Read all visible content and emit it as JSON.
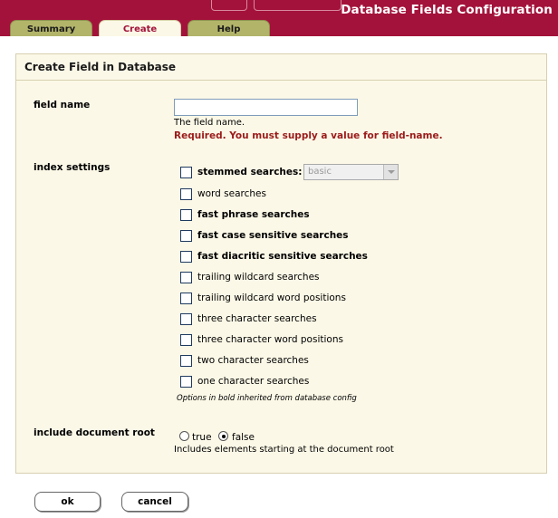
{
  "header": {
    "title": "Database Fields Configuration",
    "tabs": [
      {
        "label": "Summary",
        "active": false
      },
      {
        "label": "Create",
        "active": true
      },
      {
        "label": "Help",
        "active": false
      }
    ]
  },
  "panel": {
    "title": "Create Field in Database"
  },
  "field_name": {
    "label": "field name",
    "value": "",
    "help": "The field name.",
    "error": "Required. You must supply a value for field-name."
  },
  "index_settings": {
    "label": "index settings",
    "stemmed_select_value": "basic",
    "options": [
      {
        "label": "stemmed searches:",
        "bold": true,
        "checked": false
      },
      {
        "label": "word searches",
        "bold": false,
        "checked": false
      },
      {
        "label": "fast phrase searches",
        "bold": true,
        "checked": false
      },
      {
        "label": "fast case sensitive searches",
        "bold": true,
        "checked": false
      },
      {
        "label": "fast diacritic sensitive searches",
        "bold": true,
        "checked": false
      },
      {
        "label": "trailing wildcard searches",
        "bold": false,
        "checked": false
      },
      {
        "label": "trailing wildcard word positions",
        "bold": false,
        "checked": false
      },
      {
        "label": "three character searches",
        "bold": false,
        "checked": false
      },
      {
        "label": "three character word positions",
        "bold": false,
        "checked": false
      },
      {
        "label": "two character searches",
        "bold": false,
        "checked": false
      },
      {
        "label": "one character searches",
        "bold": false,
        "checked": false
      }
    ],
    "note": "Options in bold inherited from database config"
  },
  "include_document_root": {
    "label": "include document root",
    "options": [
      {
        "label": "true",
        "checked": false
      },
      {
        "label": "false",
        "checked": true
      }
    ],
    "help": "Includes elements starting at the document root"
  },
  "buttons": {
    "ok": "ok",
    "cancel": "cancel"
  },
  "colors": {
    "header_bg": "#a3123a",
    "panel_bg": "#fbf8e7",
    "tab_olive": "#b2b46a",
    "active_tab_text": "#a3123a",
    "error_text": "#9b1b1b"
  }
}
